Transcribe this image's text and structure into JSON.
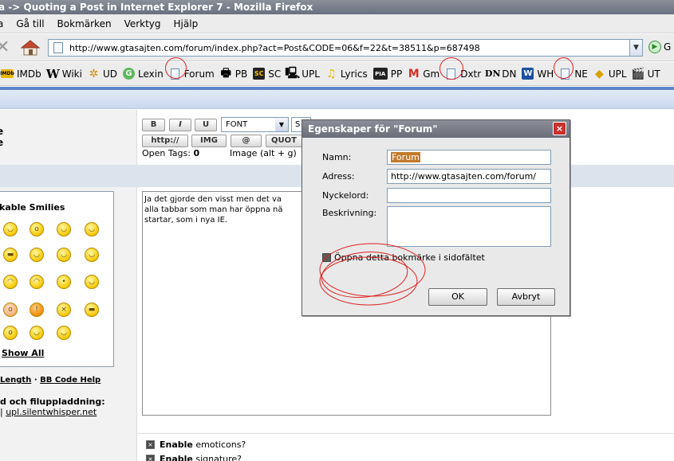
{
  "window": {
    "title": "a -> Quoting a Post in Internet Explorer 7 - Mozilla Firefox"
  },
  "menu": [
    {
      "label": "a",
      "underline": ""
    },
    {
      "label": "Gå till"
    },
    {
      "label": "Bokmärken"
    },
    {
      "label": "Verktyg"
    },
    {
      "label": "Hjälp"
    }
  ],
  "nav": {
    "url": "http://www.gtasajten.com/forum/index.php?act=Post&CODE=06&f=22&t=38511&p=687498",
    "go_label": "G"
  },
  "bookmarks": [
    {
      "label": "IMDb",
      "icon": "imdb-icon"
    },
    {
      "label": "Wiki",
      "icon": "wikipedia-icon"
    },
    {
      "label": "UD",
      "icon": "ud-icon"
    },
    {
      "label": "Lexin",
      "icon": "lexin-icon"
    },
    {
      "label": "Forum",
      "icon": "page-icon"
    },
    {
      "label": "PB",
      "icon": "pb-icon"
    },
    {
      "label": "SC",
      "icon": "sc-icon"
    },
    {
      "label": "UPL",
      "icon": "upl-icon"
    },
    {
      "label": "Lyrics",
      "icon": "lyrics-icon"
    },
    {
      "label": "PP",
      "icon": "pp-icon"
    },
    {
      "label": "Gm",
      "icon": "gmail-icon"
    },
    {
      "label": "Dxtr",
      "icon": "page-icon"
    },
    {
      "label": "DN",
      "icon": "dn-icon"
    },
    {
      "label": "WH",
      "icon": "wh-icon"
    },
    {
      "label": "NE",
      "icon": "page-icon"
    },
    {
      "label": "UPL",
      "icon": "upl2-icon"
    },
    {
      "label": "UT",
      "icon": "ut-icon"
    }
  ],
  "page": {
    "left_labels": [
      "e",
      "e"
    ],
    "toolbar": {
      "bold": "B",
      "italic": "I",
      "underline": "U",
      "font": "FONT",
      "size": "S",
      "http": "http://",
      "img": "IMG",
      "at": "@",
      "quote": "QUOT"
    },
    "open_tags_label": "Open Tags:",
    "open_tags_value": "0",
    "image_hint": "Image (alt + g)",
    "smilies_title": "kable Smilies",
    "show_all": "Show All",
    "help_links": {
      "length": "Length",
      "sep": " · ",
      "bbcode": "BB Code Help"
    },
    "upload_label": "d och filuppladdning:",
    "upload_prefix": " | ",
    "upload_link": "upl.silentwhisper.net",
    "post_text": "Ja det gjorde den visst men det va\nalla tabbar som man har öppna nä\nstartar, som i nya IE.",
    "options": [
      {
        "bold": "Enable",
        "rest": " emoticons?"
      },
      {
        "bold": "Enable",
        "rest": " signature?"
      }
    ]
  },
  "dialog": {
    "title": "Egenskaper för \"Forum\"",
    "name_label": "Namn:",
    "name_value": "Forum",
    "address_label": "Adress:",
    "address_value": "http://www.gtasajten.com/forum/",
    "keyword_label": "Nyckelord:",
    "description_label": "Beskrivning:",
    "sidebar_label": "Öppna detta bokmärke i sidofältet",
    "ok": "OK",
    "cancel": "Avbryt",
    "close": "×"
  },
  "colors": {
    "title_bar": "#6b7080",
    "accent_blue": "#5b86c9",
    "annotation_red": "#e02020",
    "selection": "#c27a2c"
  }
}
